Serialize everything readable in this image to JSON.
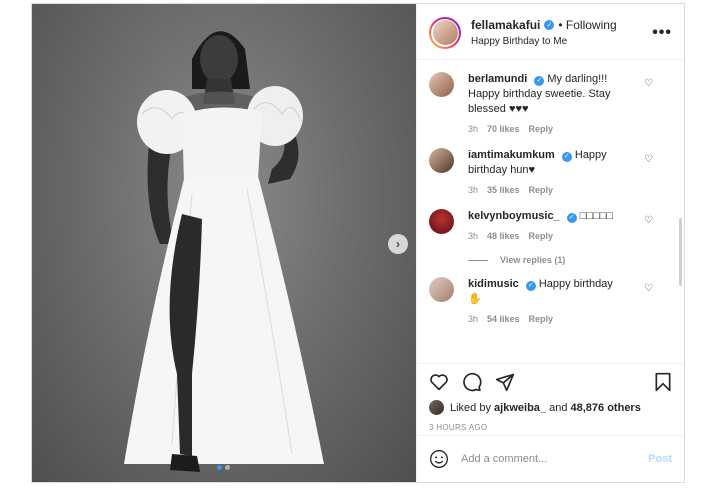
{
  "header": {
    "username": "fellamakafui",
    "separator": "•",
    "follow_status": "Following",
    "caption": "Happy Birthday to Me",
    "more": "•••"
  },
  "comments": [
    {
      "user": "berlamundi",
      "verified": true,
      "text": "My darling!!! Happy birthday sweetie. Stay blessed ♥♥♥",
      "time": "3h",
      "likes": "70 likes",
      "reply": "Reply"
    },
    {
      "user": "iamtimakumkum",
      "verified": true,
      "text": "Happy birthday hun♥",
      "time": "3h",
      "likes": "35 likes",
      "reply": "Reply"
    },
    {
      "user": "kelvynboymusic_",
      "verified": true,
      "text": "□□□□□",
      "time": "3h",
      "likes": "48 likes",
      "reply": "Reply"
    },
    {
      "user": "kidimusic",
      "verified": true,
      "text": "Happy birthday ✋",
      "time": "3h",
      "likes": "54 likes",
      "reply": "Reply"
    }
  ],
  "view_replies": "View replies (1)",
  "likes": {
    "prefix": "Liked by",
    "user": "ajkweiba_",
    "connector": "and",
    "others": "48,876 others"
  },
  "timestamp": "3 HOURS AGO",
  "comment_box": {
    "placeholder": "Add a comment...",
    "post_label": "Post"
  },
  "colors": {
    "verified": "#3897f0",
    "heart_red": "#c0142b",
    "post_disabled": "#b3dbff"
  }
}
